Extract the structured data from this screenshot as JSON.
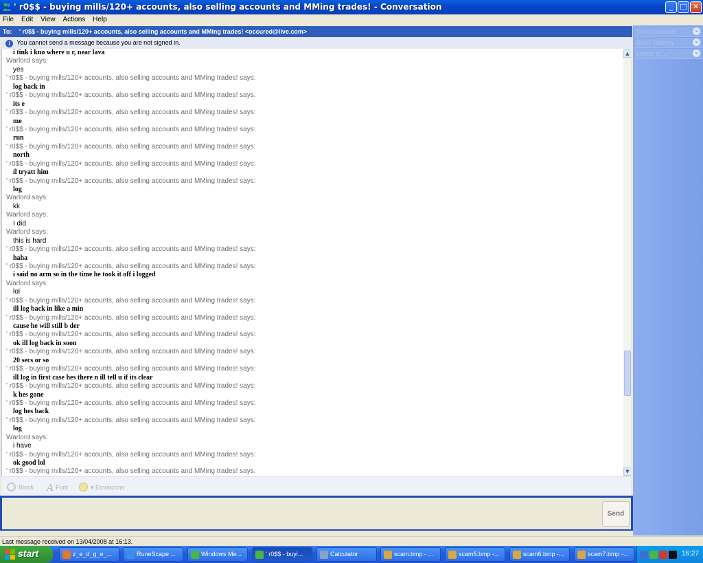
{
  "window": {
    "title": "' r0$$ - buying mills/120+ accounts, also selling accounts and MMing trades! - Conversation",
    "controls": {
      "minimize": "_",
      "maximize": "□",
      "close": "✕"
    }
  },
  "menu": [
    "File",
    "Edit",
    "View",
    "Actions",
    "Help"
  ],
  "to_bar": {
    "label": "To:",
    "value": "' r0$$ - buying mills/120+ accounts, also selling accounts and MMing trades! <occured@live.com>"
  },
  "info_bar": {
    "icon": "info-icon",
    "text": "You cannot send a message because you are not signed in."
  },
  "conversation": [
    {
      "type": "text-r",
      "text": "i tink i kno where u r, near lava"
    },
    {
      "type": "sender",
      "text": "Warlord says:"
    },
    {
      "type": "text-w",
      "text": "yes"
    },
    {
      "type": "sender",
      "text": "' r0$$ - buying mills/120+ accounts, also selling accounts and MMing trades! says:"
    },
    {
      "type": "text-r",
      "text": "log back in"
    },
    {
      "type": "sender",
      "text": "' r0$$ - buying mills/120+ accounts, also selling accounts and MMing trades! says:"
    },
    {
      "type": "text-r",
      "text": "its e"
    },
    {
      "type": "sender",
      "text": "' r0$$ - buying mills/120+ accounts, also selling accounts and MMing trades! says:"
    },
    {
      "type": "text-r",
      "text": "me"
    },
    {
      "type": "sender",
      "text": "' r0$$ - buying mills/120+ accounts, also selling accounts and MMing trades! says:"
    },
    {
      "type": "text-r",
      "text": "run"
    },
    {
      "type": "sender",
      "text": "' r0$$ - buying mills/120+ accounts, also selling accounts and MMing trades! says:"
    },
    {
      "type": "text-r",
      "text": "north"
    },
    {
      "type": "sender",
      "text": "' r0$$ - buying mills/120+ accounts, also selling accounts and MMing trades! says:"
    },
    {
      "type": "text-r",
      "text": "il tryatt him"
    },
    {
      "type": "sender",
      "text": "' r0$$ - buying mills/120+ accounts, also selling accounts and MMing trades! says:"
    },
    {
      "type": "text-r",
      "text": "log"
    },
    {
      "type": "sender",
      "text": "Warlord says:"
    },
    {
      "type": "text-w",
      "text": "kk"
    },
    {
      "type": "sender",
      "text": "Warlord says:"
    },
    {
      "type": "text-w",
      "text": "I did"
    },
    {
      "type": "sender",
      "text": "Warlord says:"
    },
    {
      "type": "text-w",
      "text": "this is hard"
    },
    {
      "type": "sender",
      "text": "' r0$$ - buying mills/120+ accounts, also selling accounts and MMing trades! says:"
    },
    {
      "type": "text-r",
      "text": "haha"
    },
    {
      "type": "sender",
      "text": "' r0$$ - buying mills/120+ accounts, also selling accounts and MMing trades! says:"
    },
    {
      "type": "text-r",
      "text": "i said no arm so in the time he took it off i logged"
    },
    {
      "type": "sender",
      "text": "Warlord says:"
    },
    {
      "type": "text-w",
      "text": "lol"
    },
    {
      "type": "sender",
      "text": "' r0$$ - buying mills/120+ accounts, also selling accounts and MMing trades! says:"
    },
    {
      "type": "text-r",
      "text": "ill log back in like a min"
    },
    {
      "type": "sender",
      "text": "' r0$$ - buying mills/120+ accounts, also selling accounts and MMing trades! says:"
    },
    {
      "type": "text-r",
      "text": "cause he will still b der"
    },
    {
      "type": "sender",
      "text": "' r0$$ - buying mills/120+ accounts, also selling accounts and MMing trades! says:"
    },
    {
      "type": "text-r",
      "text": "ok ill log back in soon"
    },
    {
      "type": "sender",
      "text": "' r0$$ - buying mills/120+ accounts, also selling accounts and MMing trades! says:"
    },
    {
      "type": "text-r",
      "text": "20 secs or so"
    },
    {
      "type": "sender",
      "text": "' r0$$ - buying mills/120+ accounts, also selling accounts and MMing trades! says:"
    },
    {
      "type": "text-r",
      "text": "ill log in first case hes there n ill tell u if its clear"
    },
    {
      "type": "sender",
      "text": "' r0$$ - buying mills/120+ accounts, also selling accounts and MMing trades! says:"
    },
    {
      "type": "text-r",
      "text": "k hes gone"
    },
    {
      "type": "sender",
      "text": "' r0$$ - buying mills/120+ accounts, also selling accounts and MMing trades! says:"
    },
    {
      "type": "text-r",
      "text": "log hes back"
    },
    {
      "type": "sender",
      "text": "' r0$$ - buying mills/120+ accounts, also selling accounts and MMing trades! says:"
    },
    {
      "type": "text-r",
      "text": "log"
    },
    {
      "type": "sender",
      "text": "Warlord says:"
    },
    {
      "type": "text-w",
      "text": "i have"
    },
    {
      "type": "sender",
      "text": "' r0$$ - buying mills/120+ accounts, also selling accounts and MMing trades! says:"
    },
    {
      "type": "text-r",
      "text": "ok good lol"
    },
    {
      "type": "sender",
      "text": "' r0$$ - buying mills/120+ accounts, also selling accounts and MMing trades! says:"
    }
  ],
  "toolbar": {
    "block": "Block",
    "font": "Font",
    "emoticons": "Emoticons",
    "emoticons_prefix": "▾"
  },
  "send_button": "Send",
  "right_pane": [
    {
      "label": "Start Camera",
      "icon": "chevron-down-icon"
    },
    {
      "label": "Start Talking",
      "icon": "chevron-down-icon"
    },
    {
      "label": "I want to...",
      "icon": "chevron-down-icon"
    }
  ],
  "status": "Last message received on 13/04/2008 at 16:13.",
  "taskbar": {
    "start": "start",
    "tasks": [
      {
        "label": "z_e_d_g_e_...",
        "icon": "firefox-icon",
        "color": "#e8762b"
      },
      {
        "label": "RuneScape ...",
        "icon": "ie-icon",
        "color": "#3a8ee8"
      },
      {
        "label": "Windows Me...",
        "icon": "messenger-icon",
        "color": "#49b544"
      },
      {
        "label": "' r0$$ - buyi...",
        "icon": "messenger-icon",
        "color": "#49b544"
      },
      {
        "label": "Calculator",
        "icon": "calculator-icon",
        "color": "#8aa0c8"
      },
      {
        "label": "scam.bmp - ...",
        "icon": "paint-icon",
        "color": "#d9a640"
      },
      {
        "label": "scam5.bmp -...",
        "icon": "paint-icon",
        "color": "#d9a640"
      },
      {
        "label": "scam6.bmp -...",
        "icon": "paint-icon",
        "color": "#d9a640"
      },
      {
        "label": "scam7.bmp -...",
        "icon": "paint-icon",
        "color": "#d9a640"
      }
    ],
    "clock": "16:27"
  }
}
